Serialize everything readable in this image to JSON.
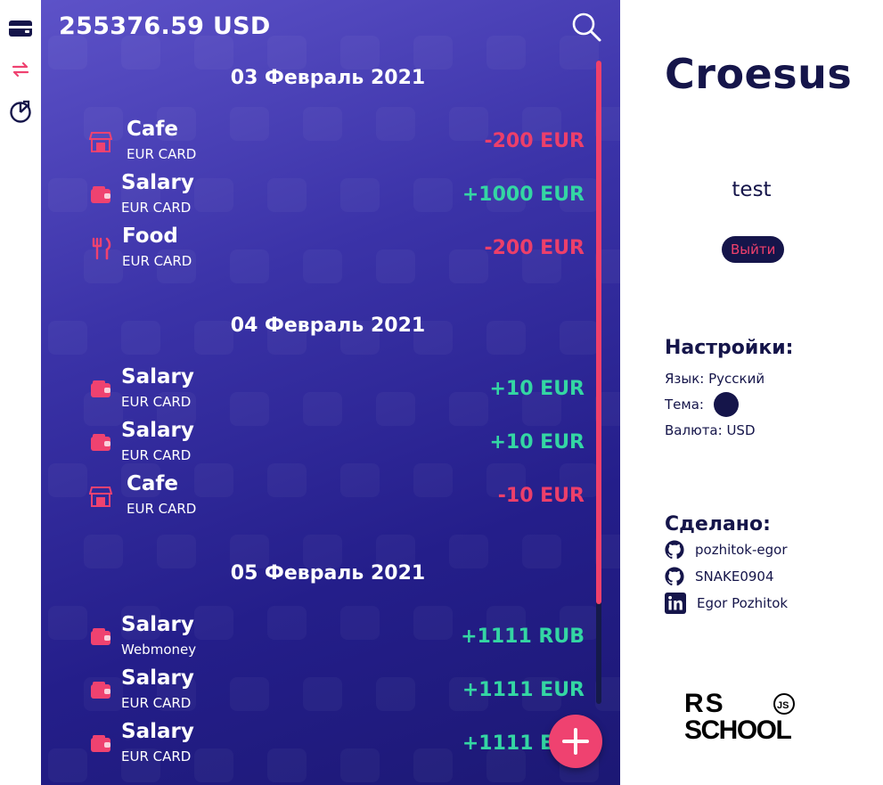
{
  "header": {
    "balance": "255376.59 USD"
  },
  "groups": [
    {
      "date": "03 Февраль 2021",
      "items": [
        {
          "name": "Cafe",
          "account": "EUR CARD",
          "amount": "-200 EUR",
          "sign": "neg",
          "icon": "cafe-icon"
        },
        {
          "name": "Salary",
          "account": "EUR CARD",
          "amount": "+1000 EUR",
          "sign": "pos",
          "icon": "wallet-icon"
        },
        {
          "name": "Food",
          "account": "EUR CARD",
          "amount": "-200 EUR",
          "sign": "neg",
          "icon": "fork-knife-icon"
        }
      ]
    },
    {
      "date": "04 Февраль 2021",
      "items": [
        {
          "name": "Salary",
          "account": "EUR CARD",
          "amount": "+10 EUR",
          "sign": "pos",
          "icon": "wallet-icon"
        },
        {
          "name": "Salary",
          "account": "EUR CARD",
          "amount": "+10 EUR",
          "sign": "pos",
          "icon": "wallet-icon"
        },
        {
          "name": "Cafe",
          "account": "EUR CARD",
          "amount": "-10 EUR",
          "sign": "neg",
          "icon": "cafe-icon"
        }
      ]
    },
    {
      "date": "05 Февраль 2021",
      "items": [
        {
          "name": "Salary",
          "account": "Webmoney",
          "amount": "+1111 RUB",
          "sign": "pos",
          "icon": "wallet-icon"
        },
        {
          "name": "Salary",
          "account": "EUR CARD",
          "amount": "+1111 EUR",
          "sign": "pos",
          "icon": "wallet-icon"
        },
        {
          "name": "Salary",
          "account": "EUR CARD",
          "amount": "+1111 EUR",
          "sign": "pos",
          "icon": "wallet-icon"
        }
      ]
    }
  ],
  "side": {
    "brand": "Croesus",
    "username": "test",
    "logout": "Выйти",
    "settings_title": "Настройки:",
    "language": "Язык: Русский",
    "theme": "Тема:",
    "currency": "Валюта: USD",
    "credits_title": "Сделано:",
    "credits": [
      {
        "label": "pozhitok-egor",
        "icon": "github-icon"
      },
      {
        "label": "SNAKE0904",
        "icon": "github-icon"
      },
      {
        "label": "Egor Pozhitok",
        "icon": "linkedin-icon"
      }
    ],
    "school_logo": {
      "line1": "RS",
      "line2": "SCHOOL",
      "badge": "JS"
    }
  },
  "colors": {
    "negative": "#ec3f6a",
    "positive": "#34d6a3",
    "accent": "#ef4270",
    "dark": "#15154a",
    "panel": "#3b33a8"
  }
}
